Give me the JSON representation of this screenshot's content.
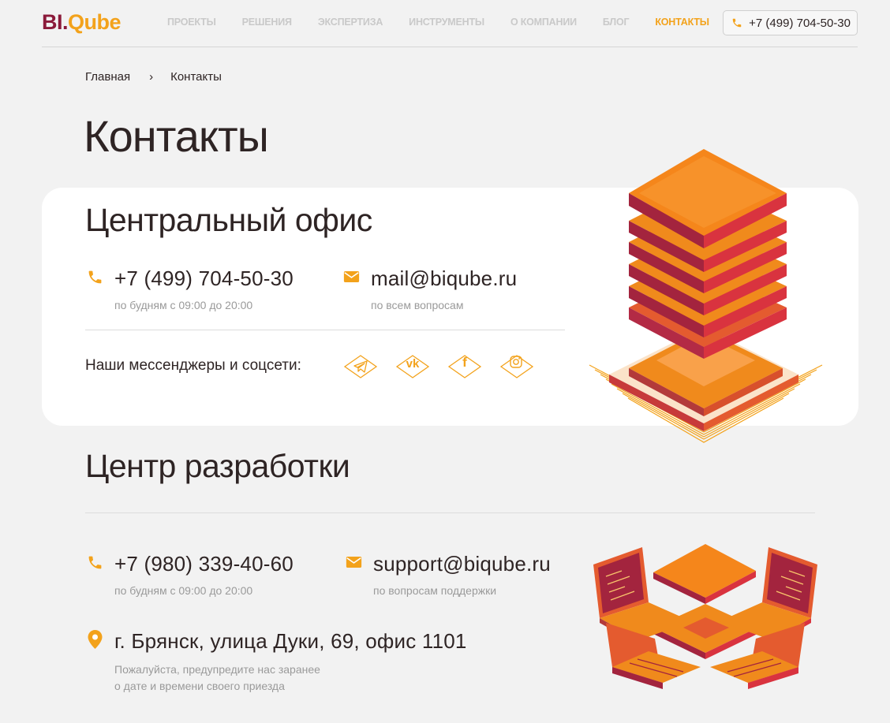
{
  "header": {
    "logo_part1": "BI.",
    "logo_part2": "Qube",
    "nav": [
      "ПРОЕКТЫ",
      "РЕШЕНИЯ",
      "ЭКСПЕРТИЗА",
      "ИНСТРУМЕНТЫ",
      "О КОМПАНИИ",
      "БЛОГ",
      "КОНТАКТЫ"
    ],
    "active_nav": "КОНТАКТЫ",
    "phone": "+7 (499) 704-50-30"
  },
  "breadcrumb": {
    "home": "Главная",
    "separator": "›",
    "current": "Контакты"
  },
  "page_title": "Контакты",
  "central_office": {
    "title": "Центральный офис",
    "phone": "+7 (499) 704-50-30",
    "phone_hint": "по будням с 09:00 до 20:00",
    "email": "mail@biqube.ru",
    "email_hint": "по всем вопросам",
    "social_label": "Наши мессенджеры и соцсети:",
    "socials": [
      {
        "icon": "telegram-icon"
      },
      {
        "icon": "vk-icon",
        "glyph": "vk"
      },
      {
        "icon": "facebook-icon",
        "glyph": "f"
      },
      {
        "icon": "instagram-icon"
      }
    ]
  },
  "dev_center": {
    "title": "Центр разработки",
    "phone": "+7 (980) 339-40-60",
    "phone_hint": "по будням с 09:00 до 20:00",
    "email": "support@biqube.ru",
    "email_hint": "по вопросам поддержки",
    "address": "г. Брянск, улица Дуки, 69, офис 1101",
    "address_hint_1": "Пожалуйста, предупредите нас заранее",
    "address_hint_2": "о дате и времени своего приезда"
  },
  "colors": {
    "accent": "#f3a21b",
    "brand": "#8b1a3a",
    "text": "#2e2424",
    "muted": "#9a9a9a",
    "bg": "#f2f2f2"
  }
}
